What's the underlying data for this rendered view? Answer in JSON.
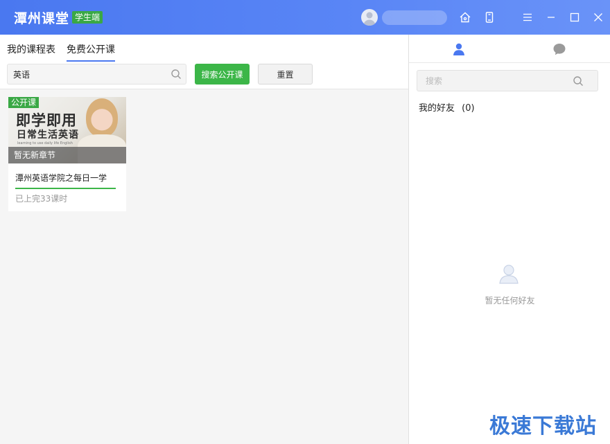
{
  "titlebar": {
    "app_name": "潭州课堂",
    "app_tag": "学生端",
    "icons": [
      "home-icon",
      "phone-icon",
      "menu-icon",
      "minimize-icon",
      "maximize-icon",
      "close-icon"
    ]
  },
  "left": {
    "tabs": [
      {
        "label": "我的课程表",
        "active": false
      },
      {
        "label": "免费公开课",
        "active": true
      }
    ],
    "search": {
      "value": "英语"
    },
    "buttons": {
      "search": "搜索公开课",
      "reset": "重置"
    },
    "course": {
      "badge": "公开课",
      "thumb_line1": "即学即用",
      "thumb_line2": "日常生活英语",
      "thumb_small": "learning to use daily life English",
      "overlay": "暂无新章节",
      "title": "潭州英语学院之每日一学",
      "subtitle": "已上完33课时"
    }
  },
  "right": {
    "tabs": [
      "contacts-icon",
      "chat-icon"
    ],
    "search": {
      "placeholder": "搜索"
    },
    "friends_label": "我的好友",
    "friends_count": "(0)",
    "empty_text": "暂无任何好友"
  },
  "watermark": "极速下载站",
  "colors": {
    "accent": "#4a78f0",
    "green": "#3cb648",
    "watermark": "#3a79d6"
  }
}
